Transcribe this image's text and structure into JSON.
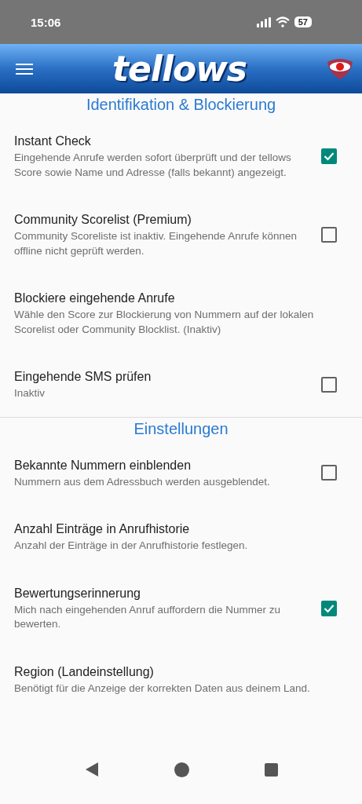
{
  "status_bar": {
    "time": "15:06",
    "battery": "57"
  },
  "app_bar": {
    "logo": "tellows"
  },
  "sections": [
    {
      "title": "Identifikation & Blockierung",
      "items": [
        {
          "kind": "checkbox",
          "title": "Instant Check",
          "summary": "Eingehende Anrufe werden sofort überprüft und der tellows Score sowie Name und Adresse (falls bekannt) angezeigt.",
          "checked": true
        },
        {
          "kind": "checkbox",
          "title": "Community Scorelist (Premium)",
          "summary": "Community Scoreliste ist inaktiv. Eingehende Anrufe können offline nicht geprüft werden.",
          "checked": false
        },
        {
          "kind": "plain",
          "title": "Blockiere eingehende Anrufe",
          "summary": "Wähle den Score zur Blockierung von Nummern auf der lokalen Scorelist oder Community Blocklist. (Inaktiv)"
        },
        {
          "kind": "checkbox",
          "title": "Eingehende SMS prüfen",
          "summary": "Inaktiv",
          "checked": false
        }
      ]
    },
    {
      "title": "Einstellungen",
      "items": [
        {
          "kind": "checkbox",
          "title": "Bekannte Nummern einblenden",
          "summary": "Nummern aus dem Adressbuch werden ausgeblendet.",
          "checked": false
        },
        {
          "kind": "plain",
          "title": "Anzahl Einträge in Anrufhistorie",
          "summary": "Anzahl der Einträge in der Anrufhistorie festlegen."
        },
        {
          "kind": "checkbox",
          "title": "Bewertungserinnerung",
          "summary": "Mich nach eingehenden Anruf auffordern die Nummer zu bewerten.",
          "checked": true
        },
        {
          "kind": "plain",
          "title": "Region (Landeinstellung)",
          "summary": "Benötigt für die Anzeige der korrekten Daten aus deinem Land."
        }
      ]
    }
  ]
}
